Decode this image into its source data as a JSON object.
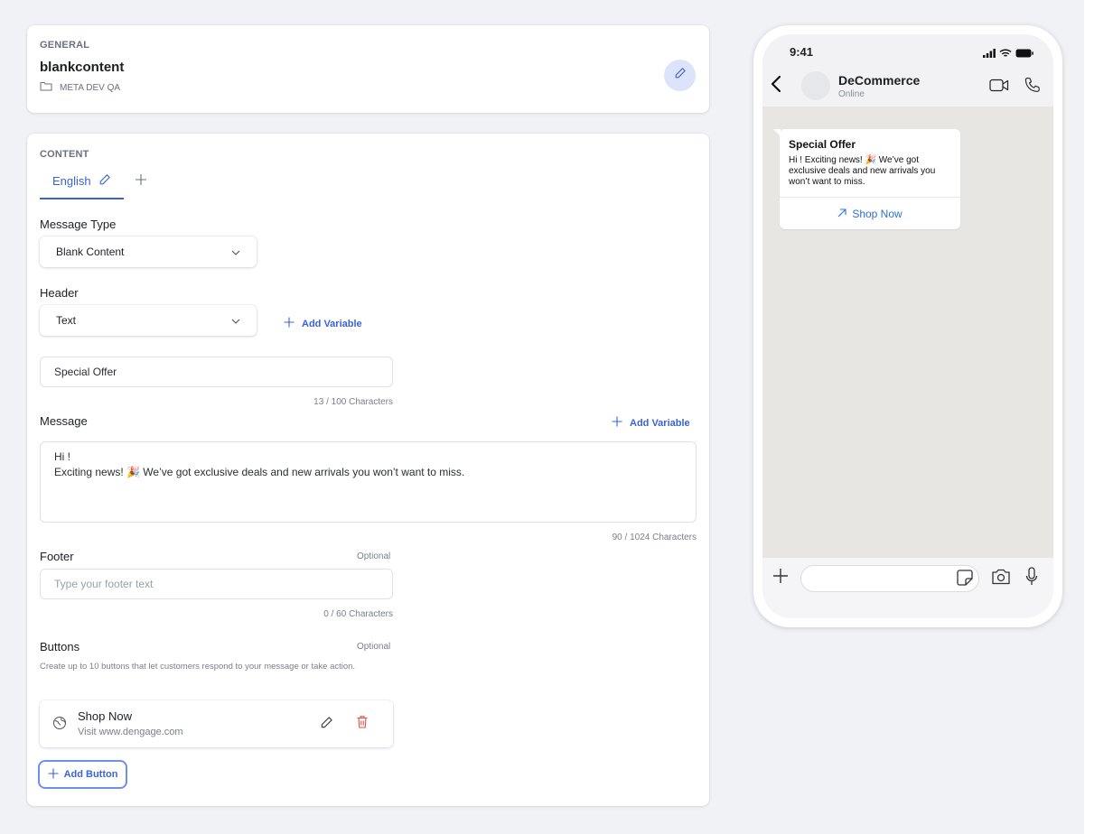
{
  "general": {
    "label": "GENERAL",
    "title": "blankcontent",
    "folder": "META DEV QA"
  },
  "content": {
    "label": "CONTENT",
    "tabs": [
      {
        "label": "English"
      }
    ],
    "message_type": {
      "label": "Message Type",
      "value": "Blank Content"
    },
    "header": {
      "label": "Header",
      "value": "Text",
      "add_variable": "Add Variable",
      "text_value": "Special Offer",
      "counter": "13 / 100 Characters"
    },
    "message": {
      "label": "Message",
      "add_variable": "Add Variable",
      "line1": "Hi !",
      "line2": "Exciting news! 🎉 We’ve got exclusive deals and new arrivals you won’t want to miss.",
      "counter": "90 / 1024 Characters"
    },
    "footer": {
      "label": "Footer",
      "optional": "Optional",
      "placeholder": "Type your footer text",
      "counter": "0 / 60 Characters"
    },
    "buttons": {
      "label": "Buttons",
      "optional": "Optional",
      "help": "Create up to 10 buttons that let customers respond to your message or take action.",
      "items": [
        {
          "title": "Shop Now",
          "subtitle": "Visit www.dengage.com"
        }
      ],
      "add_label": "Add Button"
    }
  },
  "preview": {
    "time": "9:41",
    "contact_name": "DeCommerce",
    "contact_status": "Online",
    "bubble": {
      "title": "Special Offer",
      "body": "Hi ! Exciting news! 🎉 We’ve got exclusive deals and new arrivals you won’t want to miss.",
      "button": "Shop Now"
    }
  },
  "colors": {
    "accent": "#3a63d8",
    "danger": "#e0523f",
    "link": "#2f6fd4"
  }
}
